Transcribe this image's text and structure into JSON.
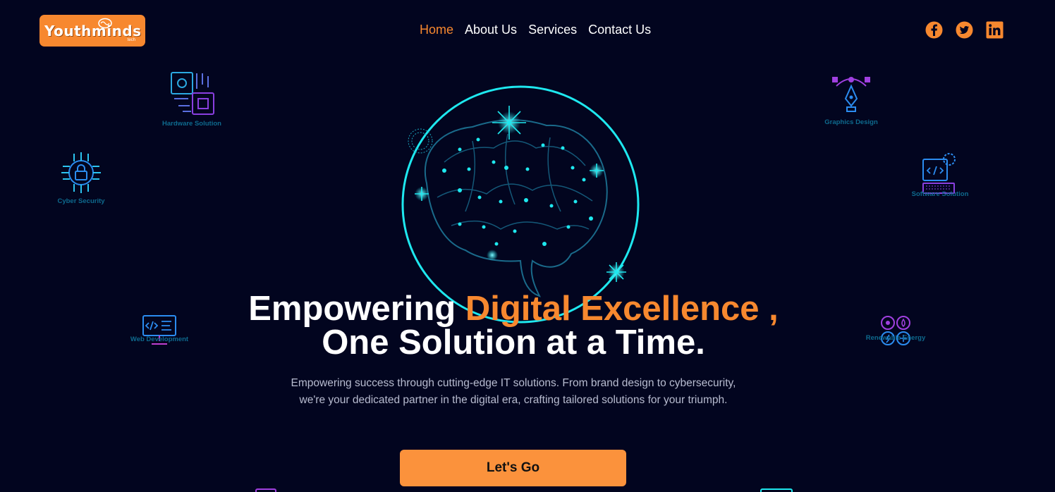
{
  "brand": {
    "name": "Youthminds",
    "sub": "tech",
    "color": "#f7882f"
  },
  "nav": {
    "items": [
      {
        "label": "Home",
        "active": true
      },
      {
        "label": "About Us",
        "active": false
      },
      {
        "label": "Services",
        "active": false
      },
      {
        "label": "Contact Us",
        "active": false
      }
    ]
  },
  "social": [
    "facebook-icon",
    "twitter-icon",
    "linkedin-icon"
  ],
  "services": {
    "hardware": "Hardware Solution",
    "cyber": "Cyber Security",
    "web": "Web Development",
    "graphics": "Graphics Design",
    "software": "Software Solution",
    "energy": "Renewable Energy"
  },
  "hero": {
    "headline_part1": "Empowering ",
    "headline_accent": "Digital Excellence ,",
    "headline_line2": "One Solution at a Time.",
    "description": "Empowering success through cutting-edge IT solutions. From brand design to cybersecurity, we're your dedicated partner in the digital era, crafting tailored solutions for your triumph.",
    "cta_label": "Let's Go"
  },
  "colors": {
    "background": "#02051f",
    "accent": "#f7882f",
    "glow": "#1ee8ef",
    "button": "#fb923c"
  }
}
